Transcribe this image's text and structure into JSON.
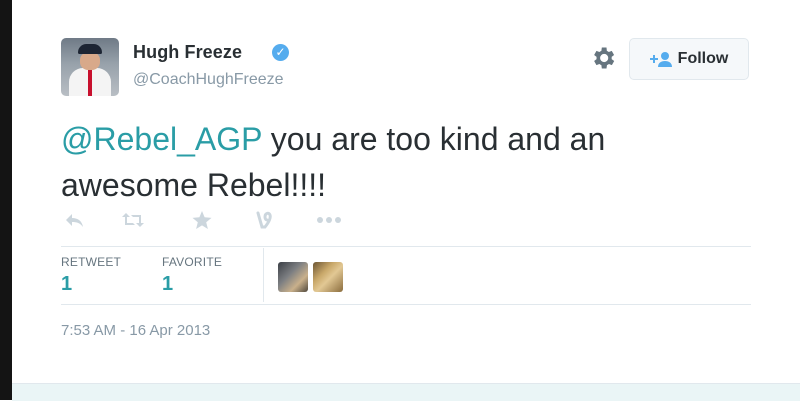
{
  "user": {
    "name": "Hugh Freeze",
    "handle": "@CoachHughFreeze",
    "verified_icon": "verified-badge-icon",
    "verified_color": "#55acee"
  },
  "header": {
    "settings_icon": "gear-icon",
    "follow_label": "Follow",
    "follow_icon": "add-user-icon"
  },
  "tweet": {
    "mention": "@Rebel_AGP",
    "text": " you are too kind and an awesome Rebel!!!!",
    "mention_color": "#2a9da6"
  },
  "actions": [
    {
      "icon": "reply-icon"
    },
    {
      "icon": "retweet-icon"
    },
    {
      "icon": "favorite-star-icon"
    },
    {
      "icon": "vine-share-icon"
    },
    {
      "icon": "more-dots-icon"
    }
  ],
  "stats": {
    "retweet_label": "RETWEET",
    "retweet_count": "1",
    "favorite_label": "FAVORITE",
    "favorite_count": "1"
  },
  "timestamp": "7:53 AM - 16 Apr 2013",
  "colors": {
    "text": "#292f33",
    "muted": "#8899a6",
    "accent": "#2a9da6",
    "border": "#e1e8ed"
  }
}
